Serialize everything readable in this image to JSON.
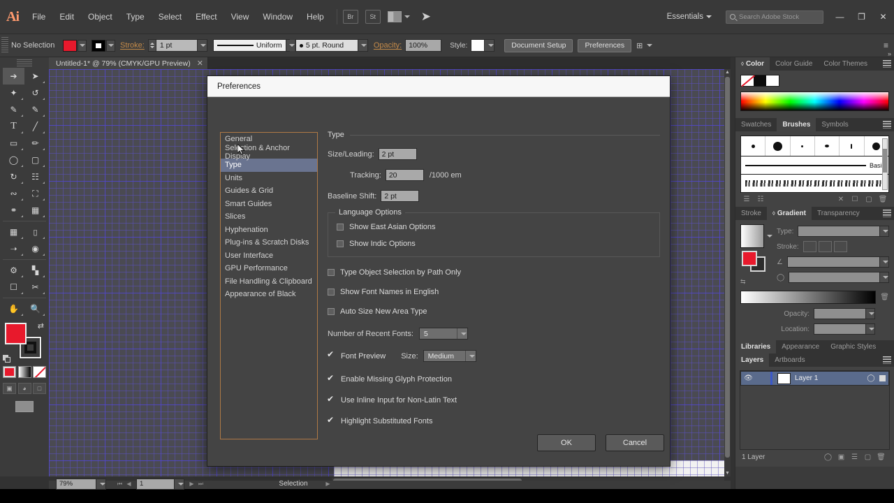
{
  "app": {
    "name": "Adobe Illustrator",
    "logo": "Ai"
  },
  "menubar": {
    "items": [
      "File",
      "Edit",
      "Object",
      "Type",
      "Select",
      "Effect",
      "View",
      "Window",
      "Help"
    ],
    "bridge_label": "Br",
    "stock_label": "St",
    "workspace": "Essentials",
    "search_placeholder": "Search Adobe Stock",
    "window_minimize": "—",
    "window_restore": "❐",
    "window_close": "✕"
  },
  "controlbar": {
    "selection_state": "No Selection",
    "fill_color": "#e8192c",
    "stroke_label": "Stroke:",
    "stroke_weight": "1 pt",
    "profile": "Uniform",
    "brush": "5 pt. Round",
    "opacity_label": "Opacity:",
    "opacity_value": "100%",
    "style_label": "Style:",
    "document_setup": "Document Setup",
    "preferences": "Preferences"
  },
  "document_tab": {
    "title": "Untitled-1* @ 79% (CMYK/GPU Preview)",
    "close": "✕"
  },
  "statusbar": {
    "zoom": "79%",
    "artboard": "1",
    "status": "Selection"
  },
  "panels": {
    "color": {
      "tabs": [
        "Color",
        "Color Guide",
        "Color Themes"
      ],
      "active": "Color"
    },
    "brushes": {
      "tabs": [
        "Swatches",
        "Brushes",
        "Symbols"
      ],
      "active": "Brushes",
      "basic_label": "Basic"
    },
    "gradient": {
      "tabs": [
        "Stroke",
        "Gradient",
        "Transparency"
      ],
      "active": "Gradient",
      "type_label": "Type:",
      "stroke_label": "Stroke:",
      "opacity_label": "Opacity:",
      "location_label": "Location:"
    },
    "libraries": {
      "tabs": [
        "Libraries",
        "Appearance",
        "Graphic Styles"
      ],
      "active": "Libraries"
    },
    "layers": {
      "tabs": [
        "Layers",
        "Artboards"
      ],
      "active": "Layers",
      "rows": [
        {
          "name": "Layer 1",
          "color": "#3b58c9",
          "visible": true
        }
      ],
      "count_label": "1 Layer"
    }
  },
  "dialog": {
    "title": "Preferences",
    "categories": [
      "General",
      "Selection & Anchor Display",
      "Type",
      "Units",
      "Guides & Grid",
      "Smart Guides",
      "Slices",
      "Hyphenation",
      "Plug-ins & Scratch Disks",
      "User Interface",
      "GPU Performance",
      "File Handling & Clipboard",
      "Appearance of Black"
    ],
    "selected_category": "Type",
    "section_title": "Type",
    "fields": {
      "size_leading_label": "Size/Leading:",
      "size_leading_value": "2 pt",
      "tracking_label": "Tracking:",
      "tracking_value": "20",
      "tracking_unit": "/1000 em",
      "baseline_shift_label": "Baseline Shift:",
      "baseline_shift_value": "2 pt"
    },
    "language_options": {
      "group_label": "Language Options",
      "checkboxes": [
        {
          "label": "Show East Asian Options",
          "checked": false
        },
        {
          "label": "Show Indic Options",
          "checked": false
        }
      ]
    },
    "options": [
      {
        "label": "Type Object Selection by Path Only",
        "checked": false
      },
      {
        "label": "Show Font Names in English",
        "checked": false
      },
      {
        "label": "Auto Size New Area Type",
        "checked": false
      }
    ],
    "recent_fonts": {
      "label": "Number of Recent Fonts:",
      "value": "5"
    },
    "font_preview": {
      "label": "Font Preview",
      "checked": true,
      "size_label": "Size:",
      "size_value": "Medium"
    },
    "bottom_options": [
      {
        "label": "Enable Missing Glyph Protection",
        "checked": true
      },
      {
        "label": "Use Inline Input for Non-Latin Text",
        "checked": true
      },
      {
        "label": "Highlight Substituted Fonts",
        "checked": true
      }
    ],
    "ok_label": "OK",
    "cancel_label": "Cancel"
  },
  "toolbar": {
    "tools": [
      "selection-tool",
      "direct-selection-tool",
      "magic-wand-tool",
      "lasso-tool",
      "pen-tool",
      "curvature-tool",
      "type-tool",
      "line-segment-tool",
      "rectangle-tool",
      "paintbrush-tool",
      "shaper-tool",
      "eraser-tool",
      "rotate-tool",
      "scale-tool",
      "width-tool",
      "free-transform-tool",
      "shape-builder-tool",
      "perspective-grid-tool",
      "mesh-tool",
      "gradient-tool",
      "eyedropper-tool",
      "blend-tool",
      "symbol-sprayer-tool",
      "column-graph-tool",
      "artboard-tool",
      "slice-tool",
      "hand-tool",
      "zoom-tool"
    ],
    "fill_color": "#e8192c",
    "stroke_color": "#000000"
  }
}
